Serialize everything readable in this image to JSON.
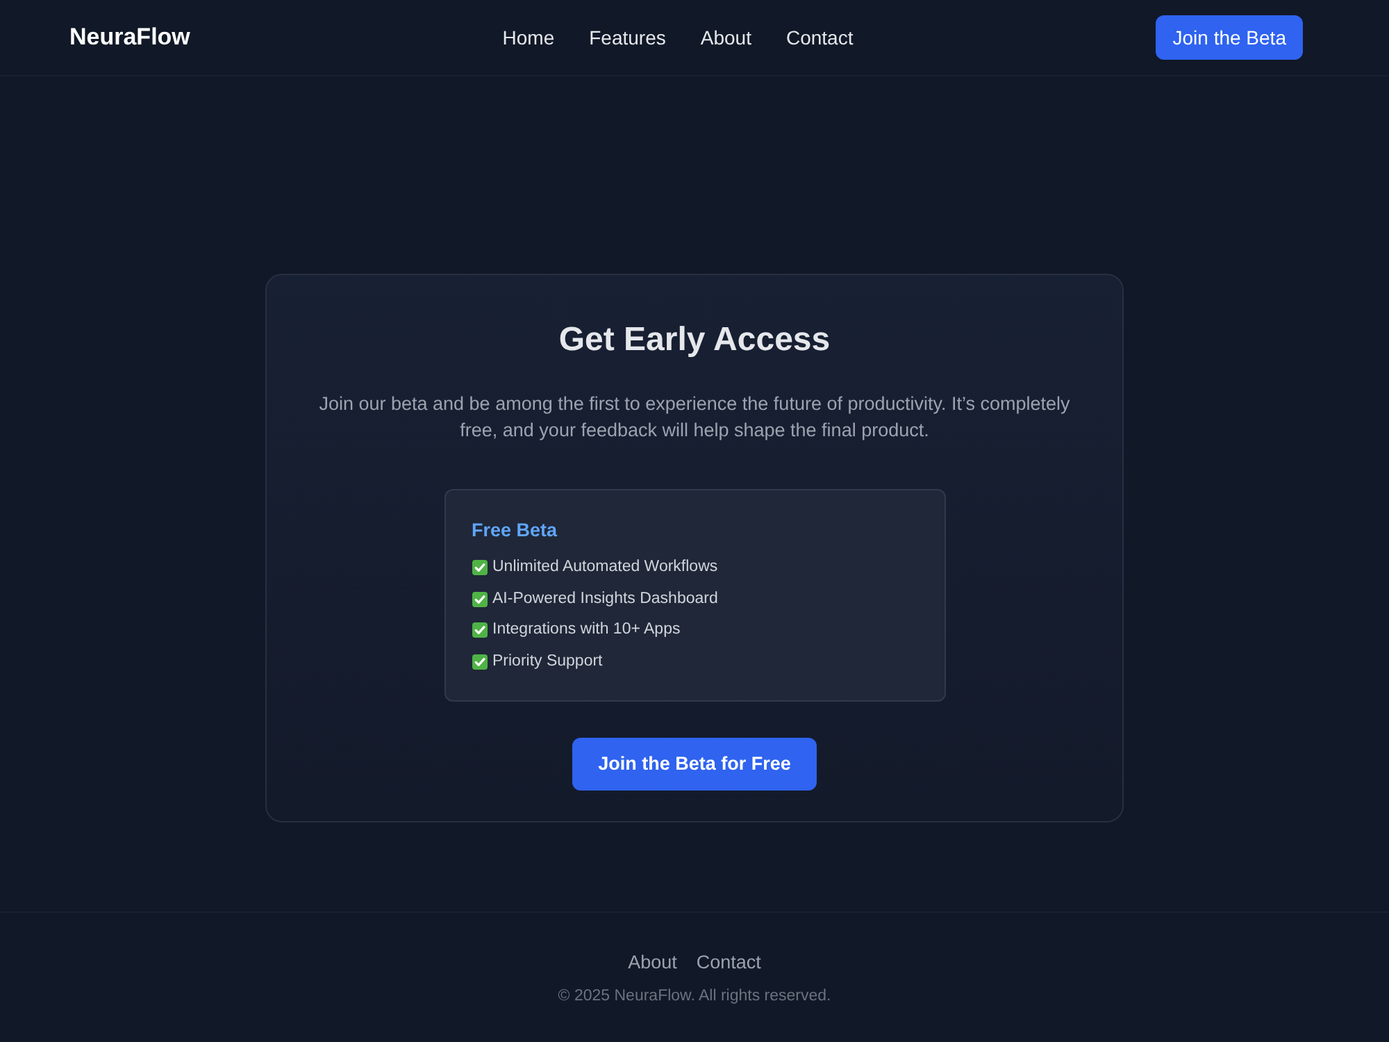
{
  "header": {
    "logo": "NeuraFlow",
    "nav": [
      "Home",
      "Features",
      "About",
      "Contact"
    ],
    "cta": "Join the Beta"
  },
  "card": {
    "title": "Get Early Access",
    "description": "Join our beta and be among the first to experience the future of productivity. It’s completely free, and your feedback will help shape the final product.",
    "plan": {
      "name": "Free Beta",
      "features": [
        "Unlimited Automated Workflows",
        "AI-Powered Insights Dashboard",
        "Integrations with 10+ Apps",
        "Priority Support"
      ]
    },
    "cta": "Join the Beta for Free"
  },
  "footer": {
    "links": [
      "About",
      "Contact"
    ],
    "copyright": "© 2025 NeuraFlow. All rights reserved."
  }
}
